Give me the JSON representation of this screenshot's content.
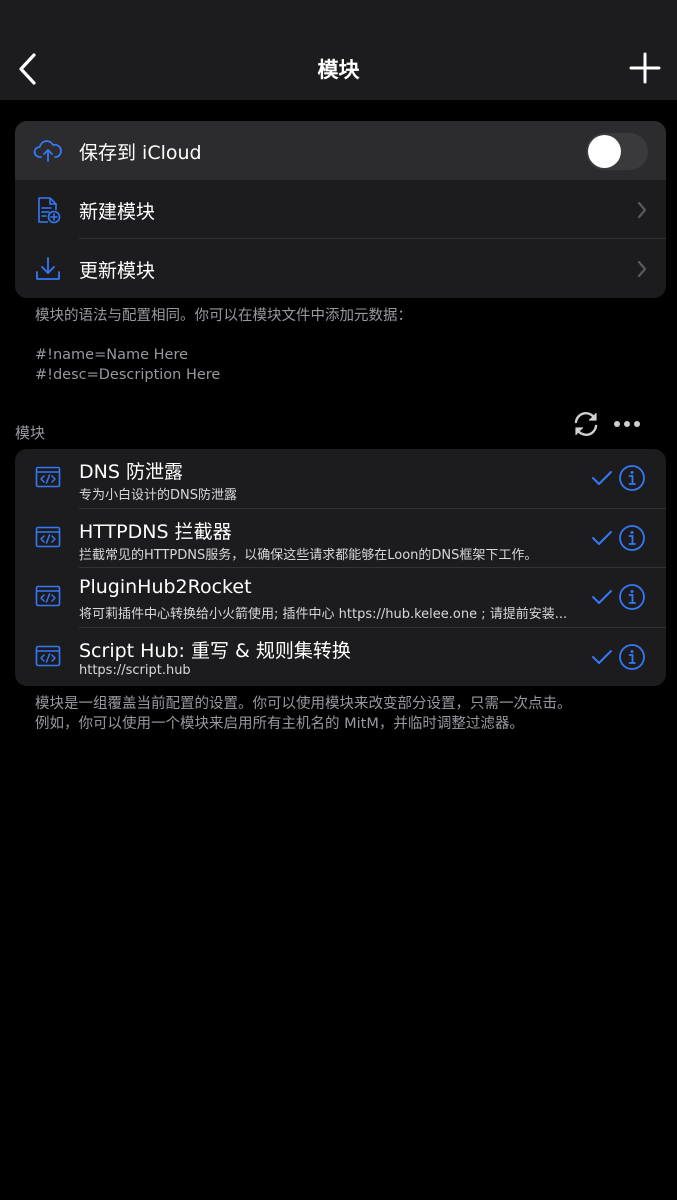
{
  "nav": {
    "title": "模块",
    "back_icon": "chevron-left-icon",
    "add_icon": "plus-icon"
  },
  "settings": {
    "icloud": {
      "label": "保存到 iCloud",
      "icon": "cloud-upload-icon",
      "enabled": false
    },
    "new_module": {
      "label": "新建模块",
      "icon": "new-document-icon"
    },
    "update_module": {
      "label": "更新模块",
      "icon": "download-icon"
    }
  },
  "settings_footer": {
    "line1": "模块的语法与配置相同。你可以在模块文件中添加元数据：",
    "line2": "#!name=Name Here",
    "line3": "#!desc=Description Here"
  },
  "modules_header": {
    "title": "模块",
    "refresh_icon": "refresh-icon",
    "more_icon": "more-icon"
  },
  "modules": [
    {
      "title": "DNS 防泄露",
      "subtitle": "专为小白设计的DNS防泄露",
      "enabled": true
    },
    {
      "title": "HTTPDNS 拦截器",
      "subtitle": "拦截常见的HTTPDNS服务，以确保这些请求都能够在Loon的DNS框架下工作。",
      "enabled": true
    },
    {
      "title": "PluginHub2Rocket",
      "subtitle": "将可莉插件中心转换给小火箭使用; 插件中心 https://hub.kelee.one ; 请提前安装...",
      "enabled": true
    },
    {
      "title": "Script Hub: 重写 & 规则集转换",
      "subtitle": "https://script.hub",
      "enabled": true
    }
  ],
  "modules_footer": {
    "line1": "模块是一组覆盖当前配置的设置。你可以使用模块来改变部分设置，只需一次点击。",
    "line2": "例如，你可以使用一个模块来启用所有主机名的 MitM，并临时调整过滤器。"
  },
  "colors": {
    "accent": "#3478f6",
    "background": "#000000",
    "group": "#1c1c1e",
    "secondary_text": "#98989f"
  }
}
